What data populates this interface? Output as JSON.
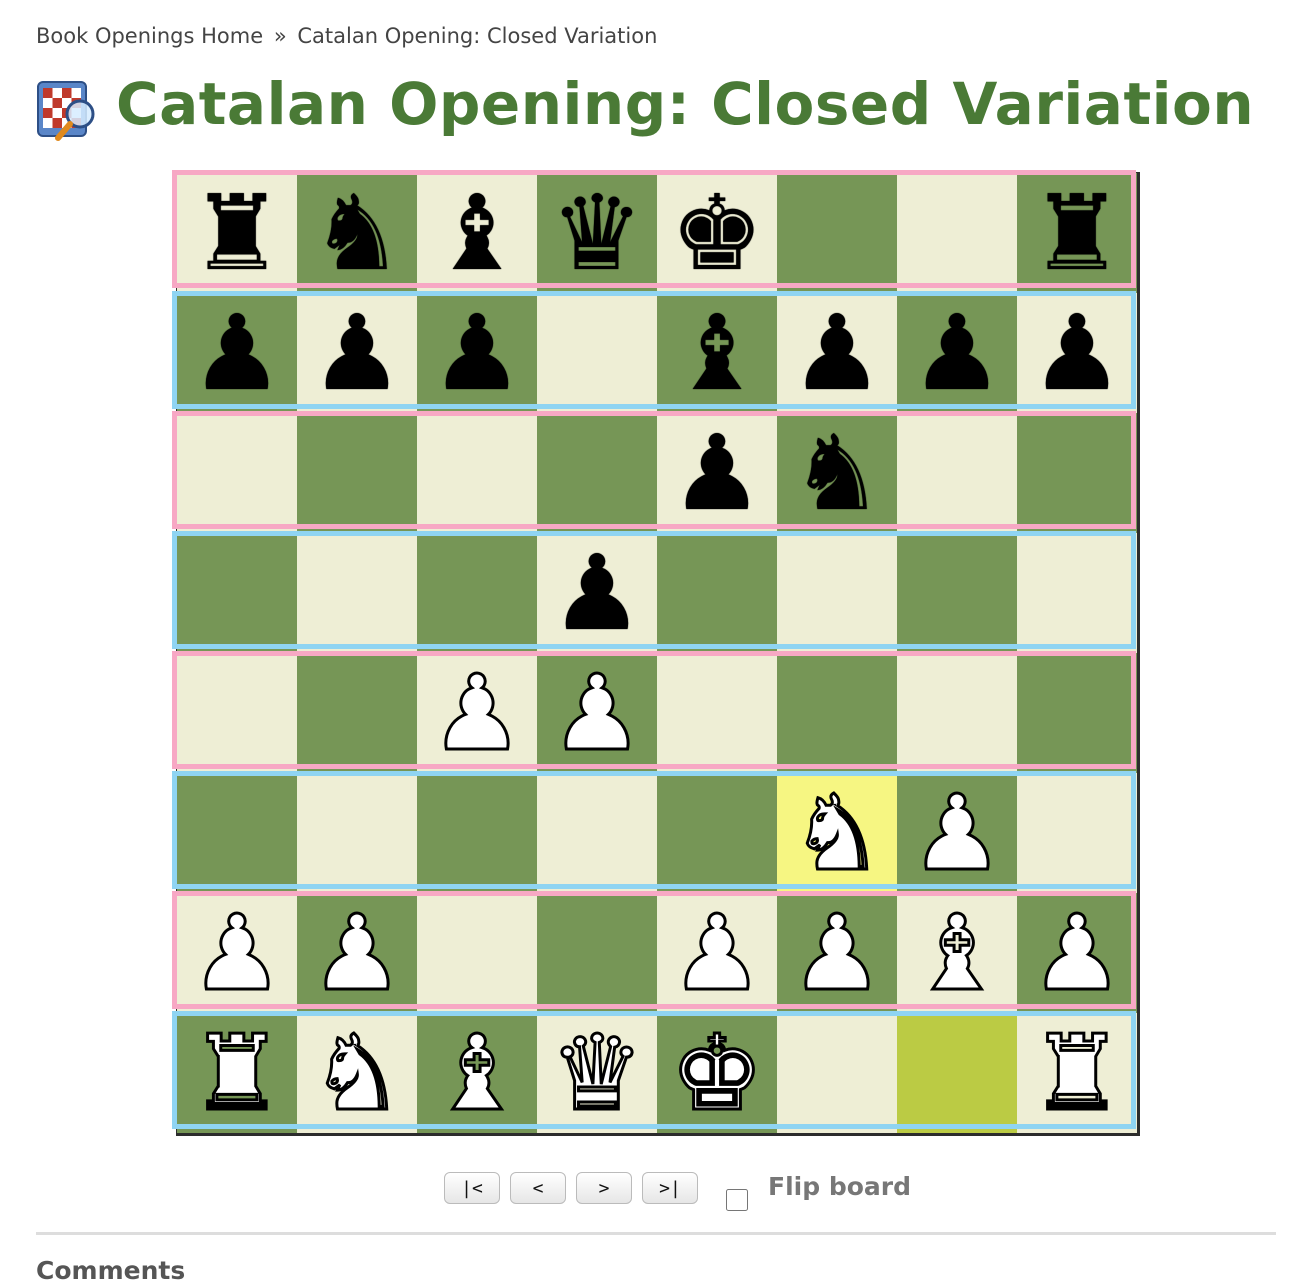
{
  "breadcrumb": {
    "home": "Book Openings Home",
    "separator": "»",
    "current": "Catalan Opening: Closed Variation"
  },
  "page": {
    "title": "Catalan Opening: Closed Variation",
    "icon": "chessboard-magnifier-icon"
  },
  "board": {
    "light_color": "#eeeed5",
    "dark_color": "#769656",
    "highlight_light": "#f6f682",
    "highlight_dark": "#bbcb44",
    "position": [
      [
        "bR",
        "bN",
        "bB",
        "bQ",
        "bK",
        "",
        "",
        "bR"
      ],
      [
        "bP",
        "bP",
        "bP",
        "",
        "bB",
        "bP",
        "bP",
        "bP"
      ],
      [
        "",
        "",
        "",
        "",
        "bP",
        "bN",
        "",
        ""
      ],
      [
        "",
        "",
        "",
        "bP",
        "",
        "",
        "",
        ""
      ],
      [
        "",
        "",
        "wP",
        "wP",
        "",
        "",
        "",
        ""
      ],
      [
        "",
        "",
        "",
        "",
        "",
        "wN",
        "wP",
        ""
      ],
      [
        "wP",
        "wP",
        "",
        "",
        "wP",
        "wP",
        "wB",
        "wP"
      ],
      [
        "wR",
        "wN",
        "wB",
        "wQ",
        "wK",
        "",
        "",
        "wR"
      ]
    ],
    "highlighted_squares": [
      "f3",
      "g1"
    ],
    "rank_outline_colors": [
      "#f7a8c4",
      "#8fd4f2"
    ]
  },
  "controls": {
    "first_label": "|<",
    "prev_label": "<",
    "next_label": ">",
    "last_label": ">|",
    "flip_label": "Flip board",
    "flip_checked": false
  },
  "comments": {
    "heading": "Comments"
  }
}
